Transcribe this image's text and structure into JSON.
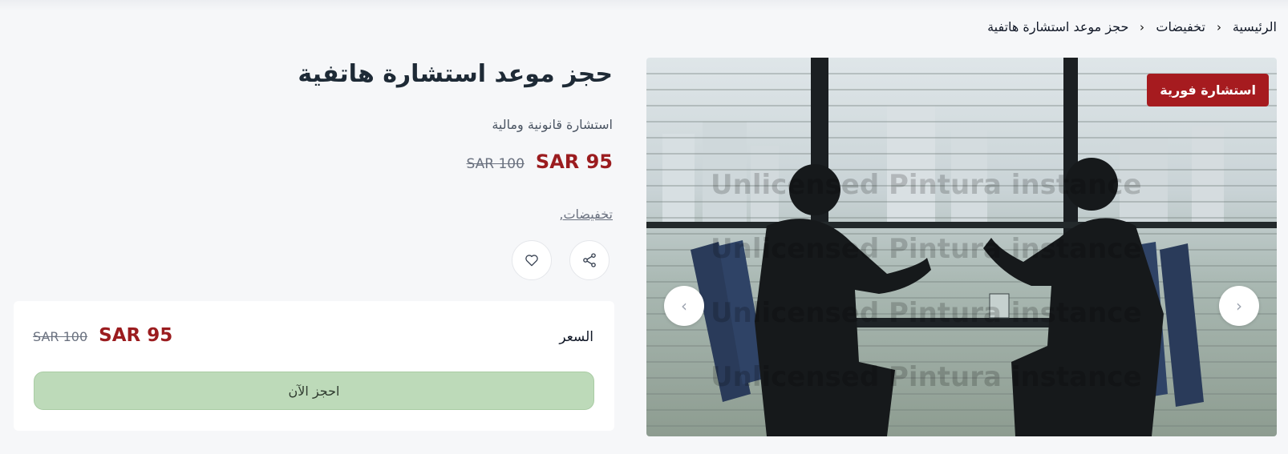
{
  "breadcrumb": {
    "items": [
      "الرئيسية",
      "تخفيضات",
      "حجز موعد استشارة هاتفية"
    ]
  },
  "product": {
    "title": "حجز موعد استشارة هاتفية",
    "subtitle": "استشارة قانونية ومالية",
    "price": "SAR 95",
    "old_price": "SAR 100",
    "category_link": "تخفيضات,",
    "badge": "استشارة فورية"
  },
  "actions": {
    "share_icon": "share-icon",
    "favorite_icon": "heart-icon"
  },
  "gallery": {
    "prev_icon": "chevron-left-icon",
    "next_icon": "chevron-right-icon",
    "watermark": "Unlicensed Pintura instance"
  },
  "purchase_card": {
    "price_label": "السعر",
    "price": "SAR 95",
    "old_price": "SAR 100",
    "book_button": "احجز الآن"
  },
  "colors": {
    "accent": "#9b1c1f",
    "badge": "#a61b1f",
    "book_button": "#bddab9"
  }
}
